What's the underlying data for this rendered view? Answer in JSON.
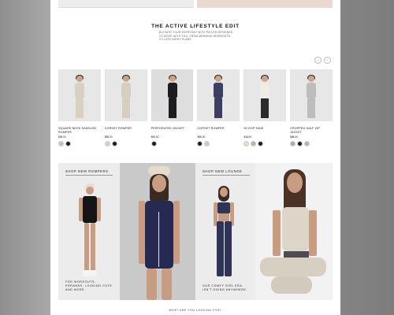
{
  "section": {
    "title": "THE ACTIVE LIFESTYLE EDIT",
    "description": "ELEVATE YOUR EVERYDAY WITH PIECES DESIGNED TO MOVE WITH YOU, FROM MORNING WORKOUTS TO LATE NIGHT PLANS."
  },
  "carousel": {
    "prev_icon": "‹",
    "next_icon": "›"
  },
  "products": [
    {
      "badge": "",
      "name": "SQUARE NECK SADDLED ROMPER",
      "price": "$98.00",
      "swatches": [
        "#cfc2a9",
        "#1c1c1c"
      ],
      "outfit": "#d8d0c0",
      "legs": "#d8d0c0"
    },
    {
      "badge": "",
      "name": "CORSET ROMPER",
      "price": "$88.00",
      "swatches": [
        "#d5d0c6",
        "#1c1c1c"
      ],
      "outfit": "#d6cfbf",
      "legs": "#d6cfbf"
    },
    {
      "badge": "",
      "name": "PERFORATED JACKET",
      "price": "$98.00",
      "swatches": [
        "#1c1c1c"
      ],
      "outfit": "#1d1d1f",
      "legs": "#1d1d1f"
    },
    {
      "badge": "",
      "name": "CORSET ROMPER",
      "price": "$88.00",
      "swatches": [
        "#1c1c1c",
        "#cfc9bd"
      ],
      "outfit": "#3c3f63",
      "legs": "#3c3f63"
    },
    {
      "badge": "",
      "name": "SCOOP TANK",
      "price": "$48.00",
      "swatches": [
        "#e4dccb",
        "#b9b59f",
        "#1c1c1c"
      ],
      "outfit": "#f1ece2",
      "legs": "#2a2a2a"
    },
    {
      "badge": "",
      "name": "CROPPED HALF ZIP JACKET",
      "price": "$88.00",
      "swatches": [
        "#a9a9a9",
        "#1c1c1c",
        "#b9b59f"
      ],
      "outfit": "#bdbdbd",
      "legs": "#bdbdbd"
    }
  ],
  "promo": {
    "rompers": {
      "heading": "SHOP NEW ROMPERS",
      "copy": "FOR WORKOUTS, ERRANDS, LOOKING CUTE AND MORE."
    },
    "lounge": {
      "heading": "SHOP NEW LOUNGE",
      "copy": "OUR COMFY GIRL ERA ISN'T GOING ANYWHERE."
    }
  },
  "footer_question": "WHAT ARE YOU LOOKING FOR?"
}
